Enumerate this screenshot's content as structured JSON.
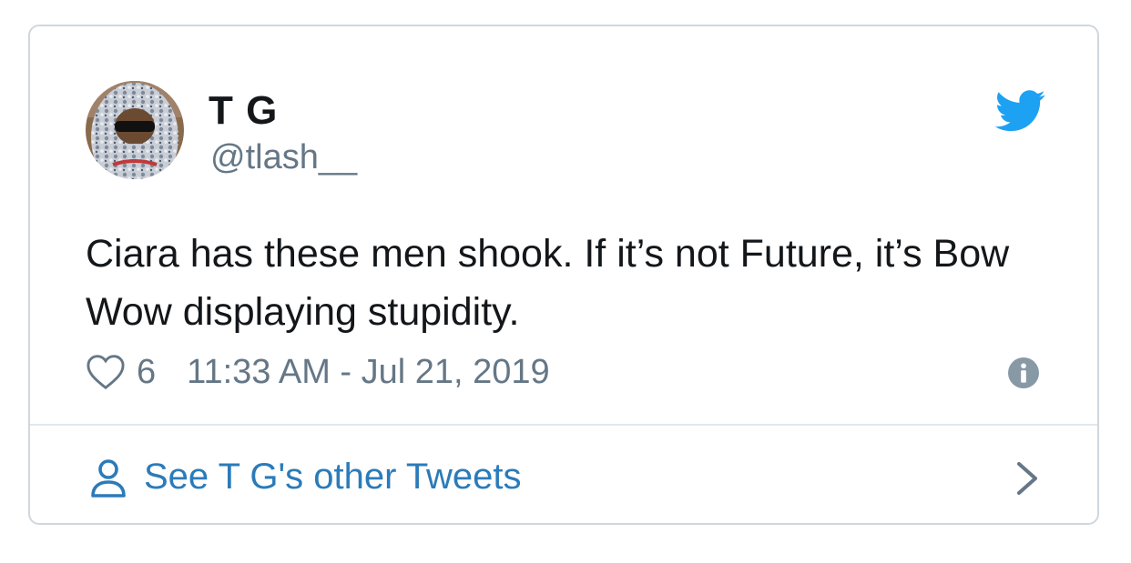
{
  "tweet": {
    "author": {
      "display_name": "T G",
      "handle": "@tlash__"
    },
    "text": "Ciara has these men shook. If it’s not Future, it’s Bow Wow displaying stupidity.",
    "likes": "6",
    "timestamp": "11:33 AM - Jul 21, 2019"
  },
  "footer": {
    "label": "See T G's other Tweets"
  },
  "icons": {
    "brand": "twitter-bird-icon",
    "like": "heart-icon",
    "info": "info-icon",
    "profile": "person-icon",
    "chevron": "chevron-right-icon"
  },
  "colors": {
    "brand_blue": "#1da1f2",
    "link_blue": "#2b7bb9",
    "text_primary": "#14171a",
    "text_secondary": "#657786",
    "border": "#d0d7de"
  }
}
